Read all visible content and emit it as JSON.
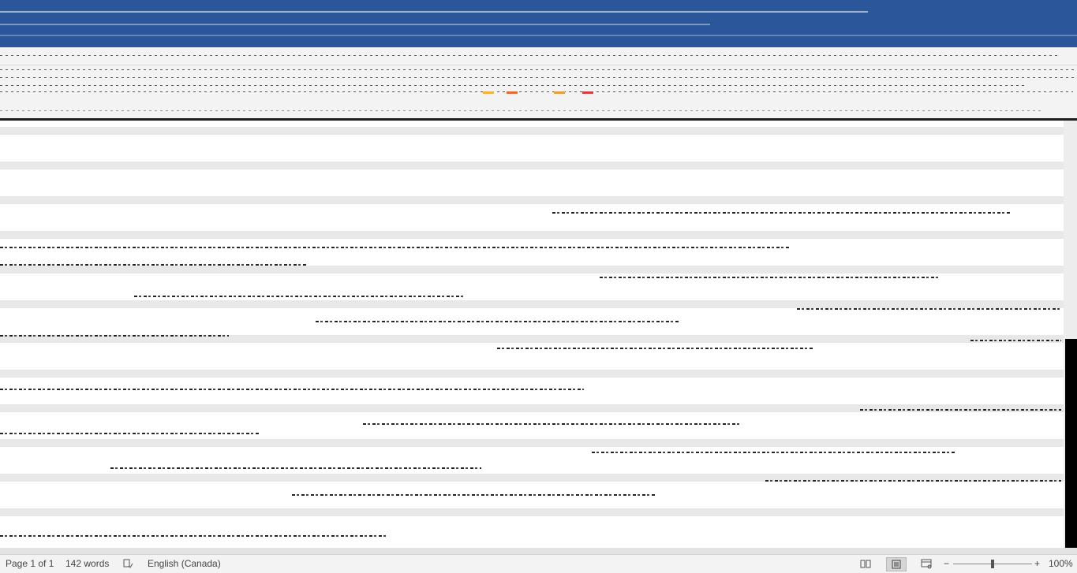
{
  "status": {
    "page_label": "Page 1 of 1",
    "word_count": "142 words",
    "language": "English (Canada)",
    "zoom_level": "100%",
    "zoom_minus": "−",
    "zoom_plus": "+",
    "active_view": "print-layout"
  },
  "icons": {
    "proofing": "proofing-icon",
    "read_mode": "read-mode-icon",
    "print_layout": "print-layout-icon",
    "web_layout": "web-layout-icon"
  },
  "colors": {
    "title_bar": "#2b579a",
    "ribbon": "#f3f3f3",
    "page": "#ffffff",
    "workspace": "#e3e3e3"
  }
}
